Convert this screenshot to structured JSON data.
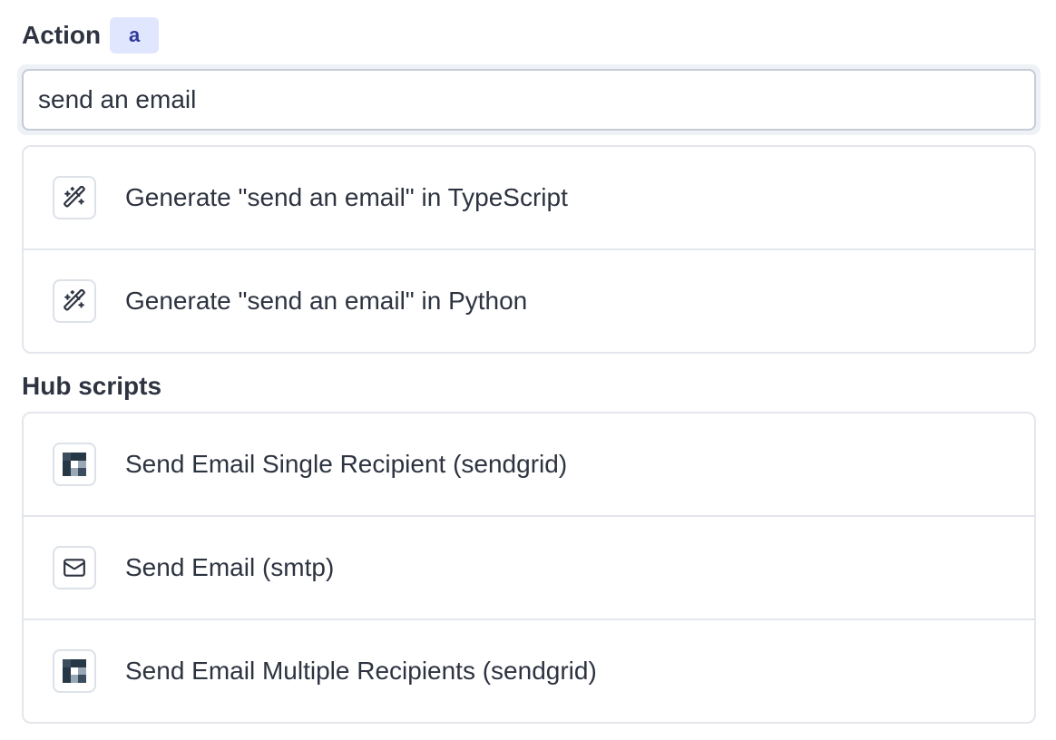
{
  "header": {
    "title": "Action",
    "shortcut": "a"
  },
  "search": {
    "value": "send an email"
  },
  "ai_options": [
    {
      "label": "Generate \"send an email\" in TypeScript",
      "icon": "magic-wand-icon"
    },
    {
      "label": "Generate \"send an email\" in Python",
      "icon": "magic-wand-icon"
    }
  ],
  "hub": {
    "title": "Hub scripts",
    "items": [
      {
        "label": "Send Email Single Recipient (sendgrid)",
        "icon": "sendgrid-logo-icon"
      },
      {
        "label": "Send Email (smtp)",
        "icon": "mail-icon"
      },
      {
        "label": "Send Email Multiple Recipients (sendgrid)",
        "icon": "sendgrid-logo-icon"
      }
    ]
  },
  "colors": {
    "text": "#2d3340",
    "badge_bg": "#e0e6fd",
    "badge_text": "#2f3a9b",
    "border": "#e3e6ec",
    "sendgrid_dark": "#263746",
    "sendgrid_light": "#9aa8b6"
  }
}
